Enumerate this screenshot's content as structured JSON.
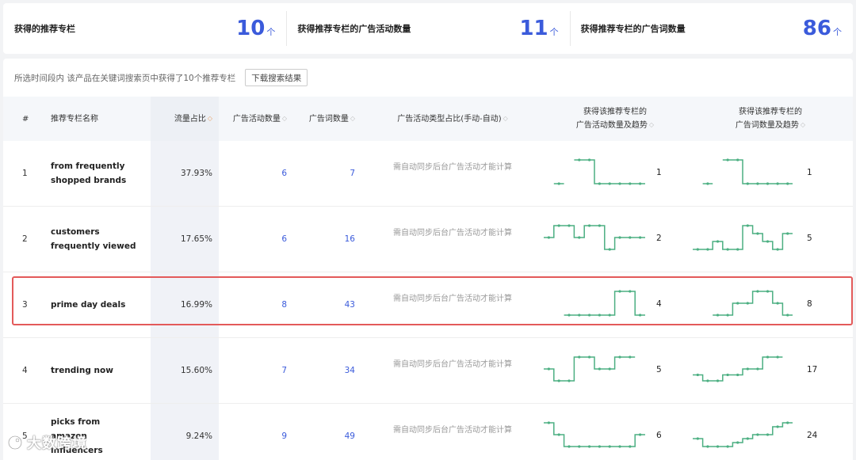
{
  "stats": [
    {
      "label": "获得的推荐专栏",
      "value": "10",
      "unit": "个"
    },
    {
      "label": "获得推荐专栏的广告活动数量",
      "value": "11",
      "unit": "个"
    },
    {
      "label": "获得推荐专栏的广告词数量",
      "value": "86",
      "unit": "个"
    }
  ],
  "toolbar": {
    "summary": "所选时间段内 该产品在关键词搜索页中获得了10个推荐专栏",
    "download_label": "下载搜索结果"
  },
  "table": {
    "headers": {
      "num": "#",
      "name": "推荐专栏名称",
      "share": "流量占比",
      "campaigns": "广告活动数量",
      "keywords": "广告词数量",
      "type": "广告活动类型占比(手动-自动)",
      "trend_campaigns_l1": "获得该推荐专栏的",
      "trend_campaigns_l2": "广告活动数量及趋势",
      "trend_keywords_l1": "获得该推荐专栏的",
      "trend_keywords_l2": "广告词数量及趋势"
    },
    "rows": [
      {
        "num": "1",
        "name": "from frequently shopped brands",
        "share": "37.93%",
        "campaigns": "6",
        "keywords": "7",
        "type": "需自动同步后台广告活动才能计算",
        "trend_campaigns_value": "1",
        "trend_keywords_value": "1",
        "trend_campaigns": [
          null,
          0,
          null,
          1,
          1,
          0,
          0,
          0,
          0,
          0
        ],
        "trend_keywords": [
          null,
          0,
          null,
          1,
          1,
          0,
          0,
          0,
          0,
          0
        ]
      },
      {
        "num": "2",
        "name": "customers frequently viewed",
        "share": "17.65%",
        "campaigns": "6",
        "keywords": "16",
        "type": "需自动同步后台广告活动才能计算",
        "trend_campaigns_value": "2",
        "trend_keywords_value": "5",
        "trend_campaigns": [
          2,
          3,
          3,
          2,
          3,
          3,
          1,
          2,
          2,
          2
        ],
        "trend_keywords": [
          2,
          2,
          3,
          2,
          2,
          5,
          4,
          3,
          2,
          4
        ]
      },
      {
        "num": "3",
        "name": "prime day deals",
        "share": "16.99%",
        "campaigns": "8",
        "keywords": "43",
        "type": "需自动同步后台广告活动才能计算",
        "trend_campaigns_value": "4",
        "trend_keywords_value": "8",
        "trend_campaigns": [
          null,
          null,
          4,
          4,
          4,
          4,
          4,
          5,
          5,
          4
        ],
        "trend_keywords": [
          null,
          null,
          6,
          6,
          7,
          7,
          8,
          8,
          7,
          6
        ]
      },
      {
        "num": "4",
        "name": "trending now",
        "share": "15.60%",
        "campaigns": "7",
        "keywords": "34",
        "type": "需自动同步后台广告活动才能计算",
        "trend_campaigns_value": "5",
        "trend_keywords_value": "17",
        "trend_campaigns": [
          6,
          5,
          5,
          7,
          7,
          6,
          6,
          7,
          7,
          null
        ],
        "trend_keywords": [
          18,
          17,
          17,
          18,
          18,
          19,
          19,
          21,
          21,
          null
        ]
      },
      {
        "num": "5",
        "name": "picks from amazon influencers",
        "share": "9.24%",
        "campaigns": "9",
        "keywords": "49",
        "type": "需自动同步后台广告活动才能计算",
        "trend_campaigns_value": "6",
        "trend_keywords_value": "24",
        "trend_campaigns": [
          8,
          7,
          6,
          6,
          6,
          6,
          6,
          6,
          6,
          7
        ],
        "trend_keywords": [
          27,
          25,
          25,
          25,
          26,
          27,
          28,
          28,
          30,
          31
        ]
      }
    ]
  },
  "watermark": "大数跨境",
  "colors": {
    "accent": "#3b5bdb",
    "trend_line": "#4caf82",
    "highlight": "#e35a5a"
  }
}
